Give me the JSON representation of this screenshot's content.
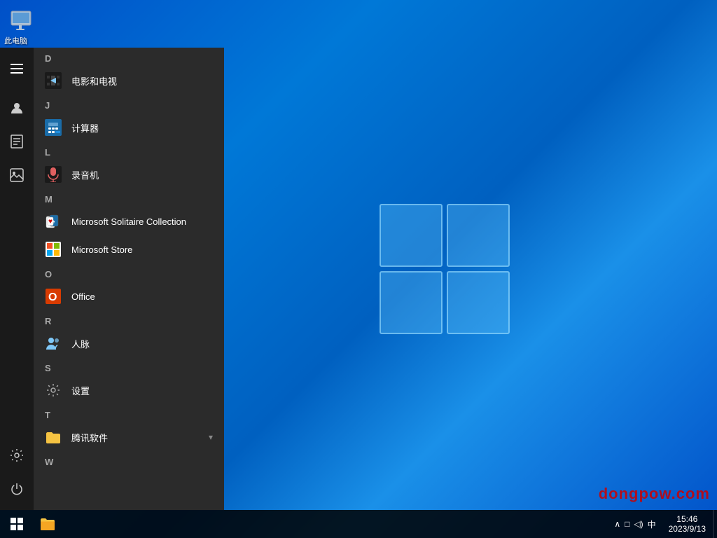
{
  "desktop": {
    "icon_label": "此电脑"
  },
  "taskbar": {
    "time": "15:46",
    "date": "2023/9/13",
    "tray_icons": [
      "^",
      "□",
      "◁)",
      "中"
    ],
    "show_desktop_label": "Show desktop"
  },
  "start_menu": {
    "sections": [
      {
        "letter": "D",
        "items": [
          {
            "name": "电影和电视",
            "icon": "film"
          }
        ]
      },
      {
        "letter": "J",
        "items": [
          {
            "name": "计算器",
            "icon": "calc"
          }
        ]
      },
      {
        "letter": "L",
        "items": [
          {
            "name": "录音机",
            "icon": "mic"
          }
        ]
      },
      {
        "letter": "M",
        "items": [
          {
            "name": "Microsoft Solitaire Collection",
            "icon": "cards"
          },
          {
            "name": "Microsoft Store",
            "icon": "store"
          }
        ]
      },
      {
        "letter": "O",
        "items": [
          {
            "name": "Office",
            "icon": "office"
          }
        ]
      },
      {
        "letter": "R",
        "items": [
          {
            "name": "人脉",
            "icon": "people"
          }
        ]
      },
      {
        "letter": "S",
        "items": [
          {
            "name": "设置",
            "icon": "settings"
          }
        ]
      },
      {
        "letter": "T",
        "items": [
          {
            "name": "腾讯软件",
            "icon": "folder",
            "has_arrow": true
          }
        ]
      },
      {
        "letter": "W",
        "items": []
      }
    ],
    "sidebar": {
      "icons": [
        "hamburger",
        "user",
        "file",
        "photos",
        "settings",
        "power"
      ]
    }
  },
  "watermark": "dongpow.com"
}
